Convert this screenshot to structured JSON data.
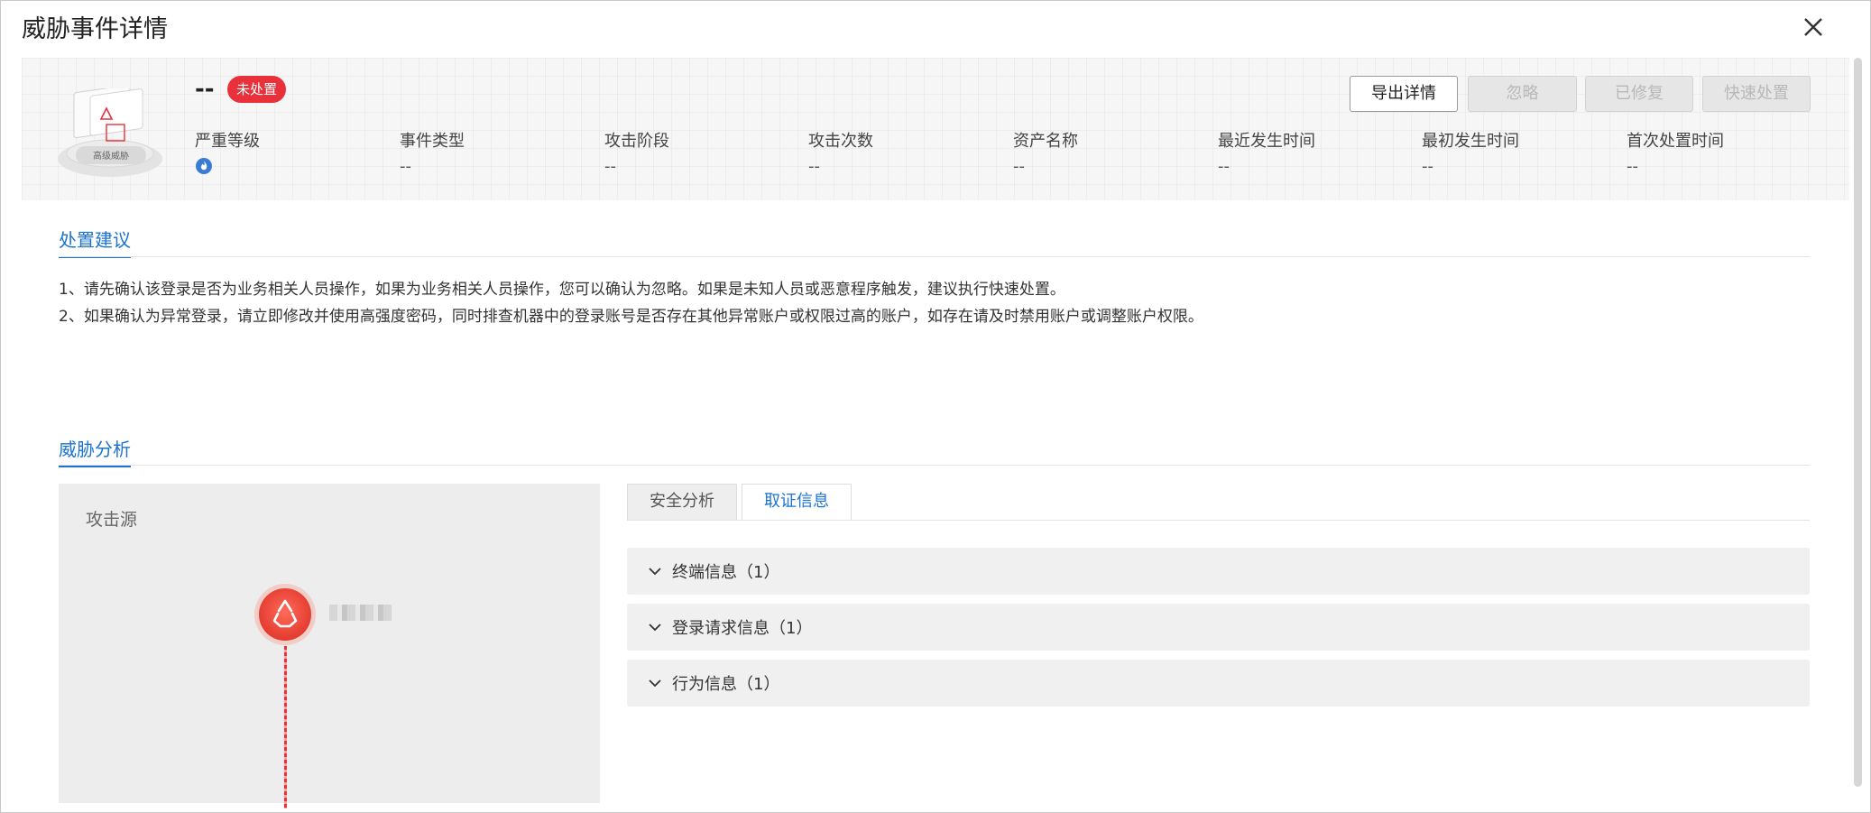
{
  "dialog": {
    "title": "威胁事件详情"
  },
  "event": {
    "name": "--",
    "status_badge": "未处置",
    "illustration_label": "高级威胁"
  },
  "actions": {
    "export": "导出详情",
    "ignore": "忽略",
    "fixed": "已修复",
    "quick": "快速处置"
  },
  "fields": [
    {
      "label": "严重等级",
      "value": ""
    },
    {
      "label": "事件类型",
      "value": "--"
    },
    {
      "label": "攻击阶段",
      "value": "--"
    },
    {
      "label": "攻击次数",
      "value": "--"
    },
    {
      "label": "资产名称",
      "value": "--"
    },
    {
      "label": "最近发生时间",
      "value": "--"
    },
    {
      "label": "最初发生时间",
      "value": "--"
    },
    {
      "label": "首次处置时间",
      "value": "--"
    }
  ],
  "severity_icon": "flame-icon",
  "advice": {
    "title": "处置建议",
    "lines": [
      "1、请先确认该登录是否为业务相关人员操作，如果为业务相关人员操作，您可以确认为忽略。如果是未知人员或恶意程序触发，建议执行快速处置。",
      "2、如果确认为异常登录，请立即修改并使用高强度密码，同时排查机器中的登录账号是否存在其他异常账户或权限过高的账户，如存在请及时禁用账户或调整账户权限。"
    ]
  },
  "analysis": {
    "title": "威胁分析",
    "attack_source_title": "攻击源",
    "tabs": [
      {
        "label": "安全分析",
        "active": false
      },
      {
        "label": "取证信息",
        "active": true
      }
    ],
    "accordions": [
      {
        "label": "终端信息（1）"
      },
      {
        "label": "登录请求信息（1）"
      },
      {
        "label": "行为信息（1）"
      }
    ]
  },
  "colors": {
    "accent": "#1d74d0",
    "danger": "#e8313a",
    "severity": "#3a7bd5"
  }
}
